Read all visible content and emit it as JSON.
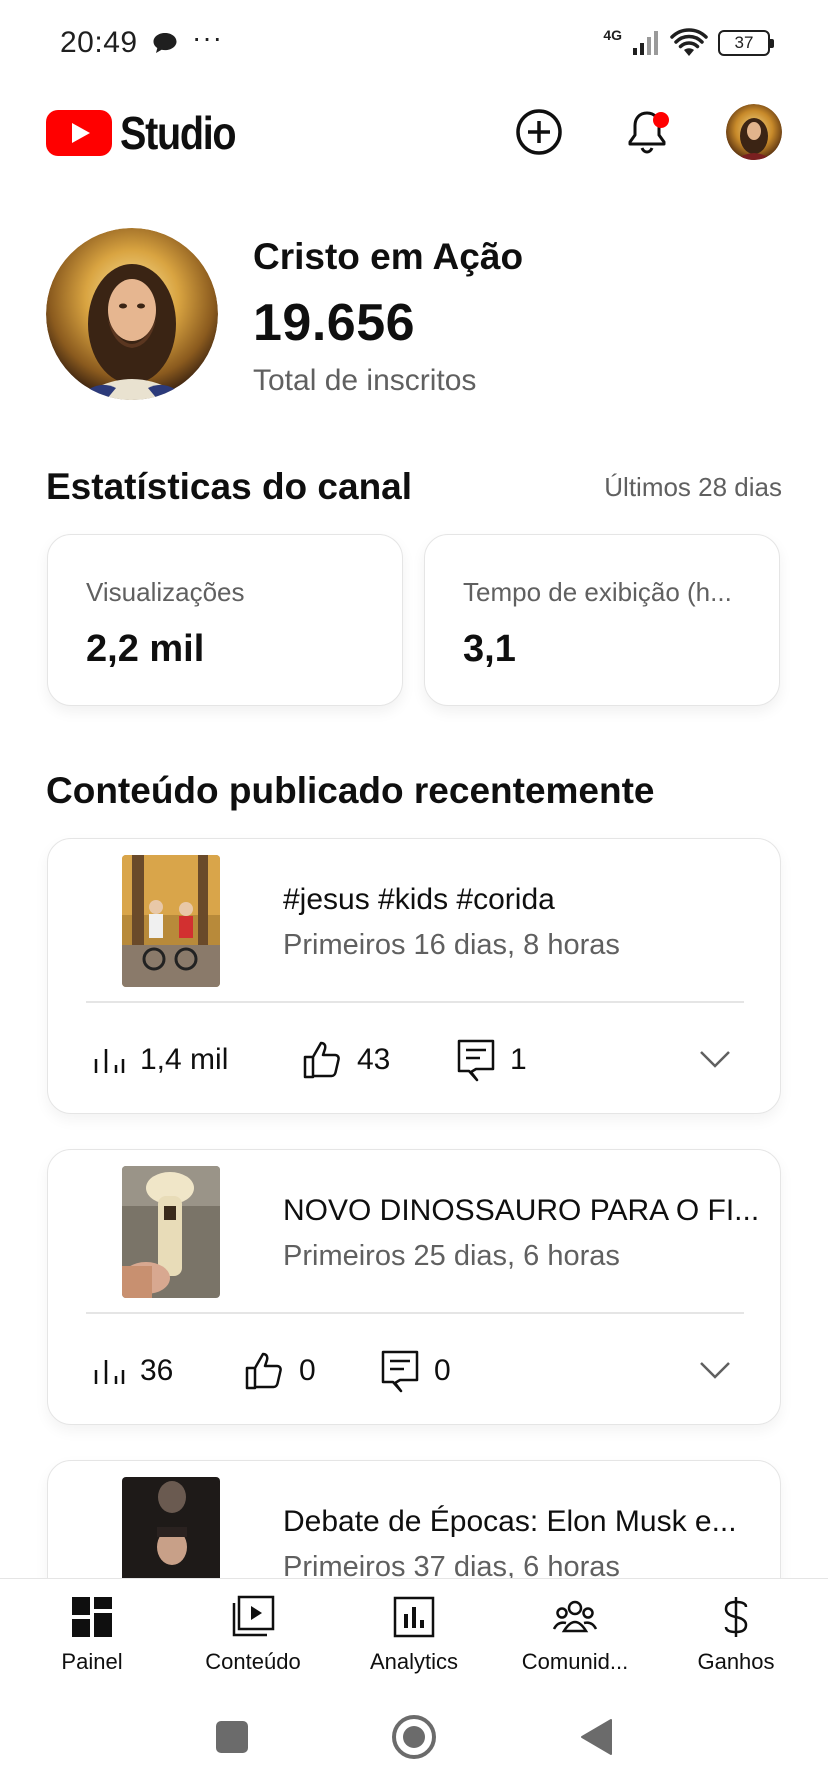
{
  "status_bar": {
    "time": "20:49",
    "dots": "···",
    "network": "4G",
    "battery": "37"
  },
  "header": {
    "logo_text": "Studio",
    "brand_color": "#ff0000",
    "notification_dot_color": "#ff0000"
  },
  "channel": {
    "name": "Cristo em Ação",
    "subscribers": "19.656",
    "subscribers_label": "Total de inscritos"
  },
  "stats": {
    "title": "Estatísticas do canal",
    "period": "Últimos 28 dias",
    "cards": [
      {
        "label": "Visualizações",
        "value": "2,2 mil"
      },
      {
        "label": "Tempo de exibição (h...",
        "value": "3,1"
      }
    ]
  },
  "recent": {
    "title": "Conteúdo publicado recentemente",
    "videos": [
      {
        "title": "#jesus #kids #corida",
        "subtitle": "Primeiros 16 dias, 8 horas",
        "views": "1,4 mil",
        "likes": "43",
        "comments": "1"
      },
      {
        "title": "NOVO DINOSSAURO PARA O FI...",
        "subtitle": "Primeiros 25 dias, 6 horas",
        "views": "36",
        "likes": "0",
        "comments": "0"
      },
      {
        "title": "Debate de Épocas: Elon Musk e...",
        "subtitle": "Primeiros 37 dias, 6 horas"
      }
    ]
  },
  "bottom_nav": {
    "items": [
      {
        "label": "Painel",
        "icon": "dashboard-icon"
      },
      {
        "label": "Conteúdo",
        "icon": "content-icon"
      },
      {
        "label": "Analytics",
        "icon": "analytics-icon"
      },
      {
        "label": "Comunid...",
        "icon": "community-icon"
      },
      {
        "label": "Ganhos",
        "icon": "dollar-icon"
      }
    ]
  }
}
